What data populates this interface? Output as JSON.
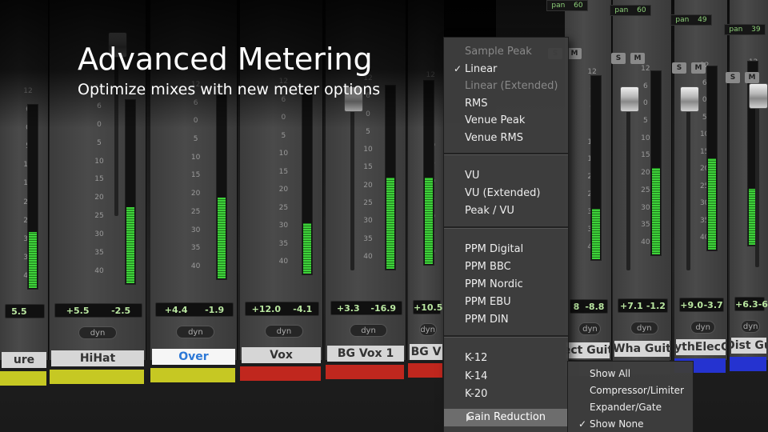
{
  "headline": {
    "title": "Advanced Metering",
    "subtitle": "Optimize mixes with new meter options"
  },
  "channels": [
    {
      "name": "ure",
      "vol_left": "5.5",
      "vol_right": "",
      "dyn": "",
      "color": "#c6c823"
    },
    {
      "name": "HiHat",
      "vol_left": "+5.5",
      "vol_right": "-2.5",
      "dyn": "dyn",
      "color": "#c6c823"
    },
    {
      "name": "Over",
      "vol_left": "+4.4",
      "vol_right": "-1.9",
      "dyn": "dyn",
      "color": "#c6c823"
    },
    {
      "name": "Vox",
      "vol_left": "+12.0",
      "vol_right": "-4.1",
      "dyn": "dyn",
      "color": "#c0271e"
    },
    {
      "name": "BG Vox 1",
      "vol_left": "+3.3",
      "vol_right": "-16.9",
      "dyn": "dyn",
      "color": "#c0271e"
    },
    {
      "name": "BG V",
      "vol_left": "+10.5",
      "vol_right": "",
      "dyn": "dyn",
      "color": "#c0271e"
    },
    {
      "name": "ect Guit",
      "vol_left": "8",
      "vol_right": "-8.8",
      "dyn": "dyn",
      "color": "#3a3a3a"
    },
    {
      "name": "Wha Guit",
      "vol_left": "+7.1",
      "vol_right": "-1.2",
      "dyn": "dyn",
      "color": "#3a3a3a"
    },
    {
      "name": "RythElecGt",
      "vol_left": "+9.0",
      "vol_right": "-3.7",
      "dyn": "dyn",
      "color": "#2533d0"
    },
    {
      "name": "Dist Gu",
      "vol_left": "+6.3",
      "vol_right": "-6",
      "dyn": "dyn",
      "color": "#2533d0"
    }
  ],
  "scale_ticks": [
    "12",
    "6",
    "0",
    "5",
    "10",
    "15",
    "20",
    "25",
    "30",
    "35",
    "40"
  ],
  "pan_labels": [
    {
      "label": "pan",
      "value": "60"
    },
    {
      "label": "pan",
      "value": "60"
    },
    {
      "label": "pan",
      "value": "49"
    },
    {
      "label": "pan",
      "value": "39"
    }
  ],
  "solo_mute": {
    "s": "S",
    "m": "M"
  },
  "meter_menu": {
    "group1": [
      {
        "label": "Sample Peak",
        "checked": false,
        "dim": true
      },
      {
        "label": "Linear",
        "checked": true,
        "dim": false
      },
      {
        "label": "Linear (Extended)",
        "checked": false,
        "dim": true
      },
      {
        "label": "RMS",
        "checked": false,
        "dim": false
      },
      {
        "label": "Venue Peak",
        "checked": false,
        "dim": false
      },
      {
        "label": "Venue RMS",
        "checked": false,
        "dim": false
      }
    ],
    "group2": [
      {
        "label": "VU"
      },
      {
        "label": "VU (Extended)"
      },
      {
        "label": "Peak / VU"
      }
    ],
    "group3": [
      {
        "label": "PPM Digital"
      },
      {
        "label": "PPM BBC"
      },
      {
        "label": "PPM Nordic"
      },
      {
        "label": "PPM EBU"
      },
      {
        "label": "PPM DIN"
      }
    ],
    "group4": [
      {
        "label": "K-12"
      },
      {
        "label": "K-14"
      },
      {
        "label": "K-20"
      }
    ],
    "gain_reduction": "Gain Reduction"
  },
  "gain_submenu": [
    {
      "label": "Show All",
      "checked": false
    },
    {
      "label": "Compressor/Limiter",
      "checked": false
    },
    {
      "label": "Expander/Gate",
      "checked": false
    },
    {
      "label": "Show None",
      "checked": true
    }
  ],
  "meter_levels": [
    0.55,
    0.75,
    0.8,
    0.0,
    0.9,
    0.85,
    0.0,
    0.85,
    0.9,
    0.55,
    0.8,
    0.95,
    0.9,
    0.6,
    0.7
  ],
  "colors": {
    "meter_green": "#3ed13a",
    "yellow_tag": "#c6c823",
    "red_tag": "#c0271e",
    "blue_tag": "#2533d0"
  }
}
